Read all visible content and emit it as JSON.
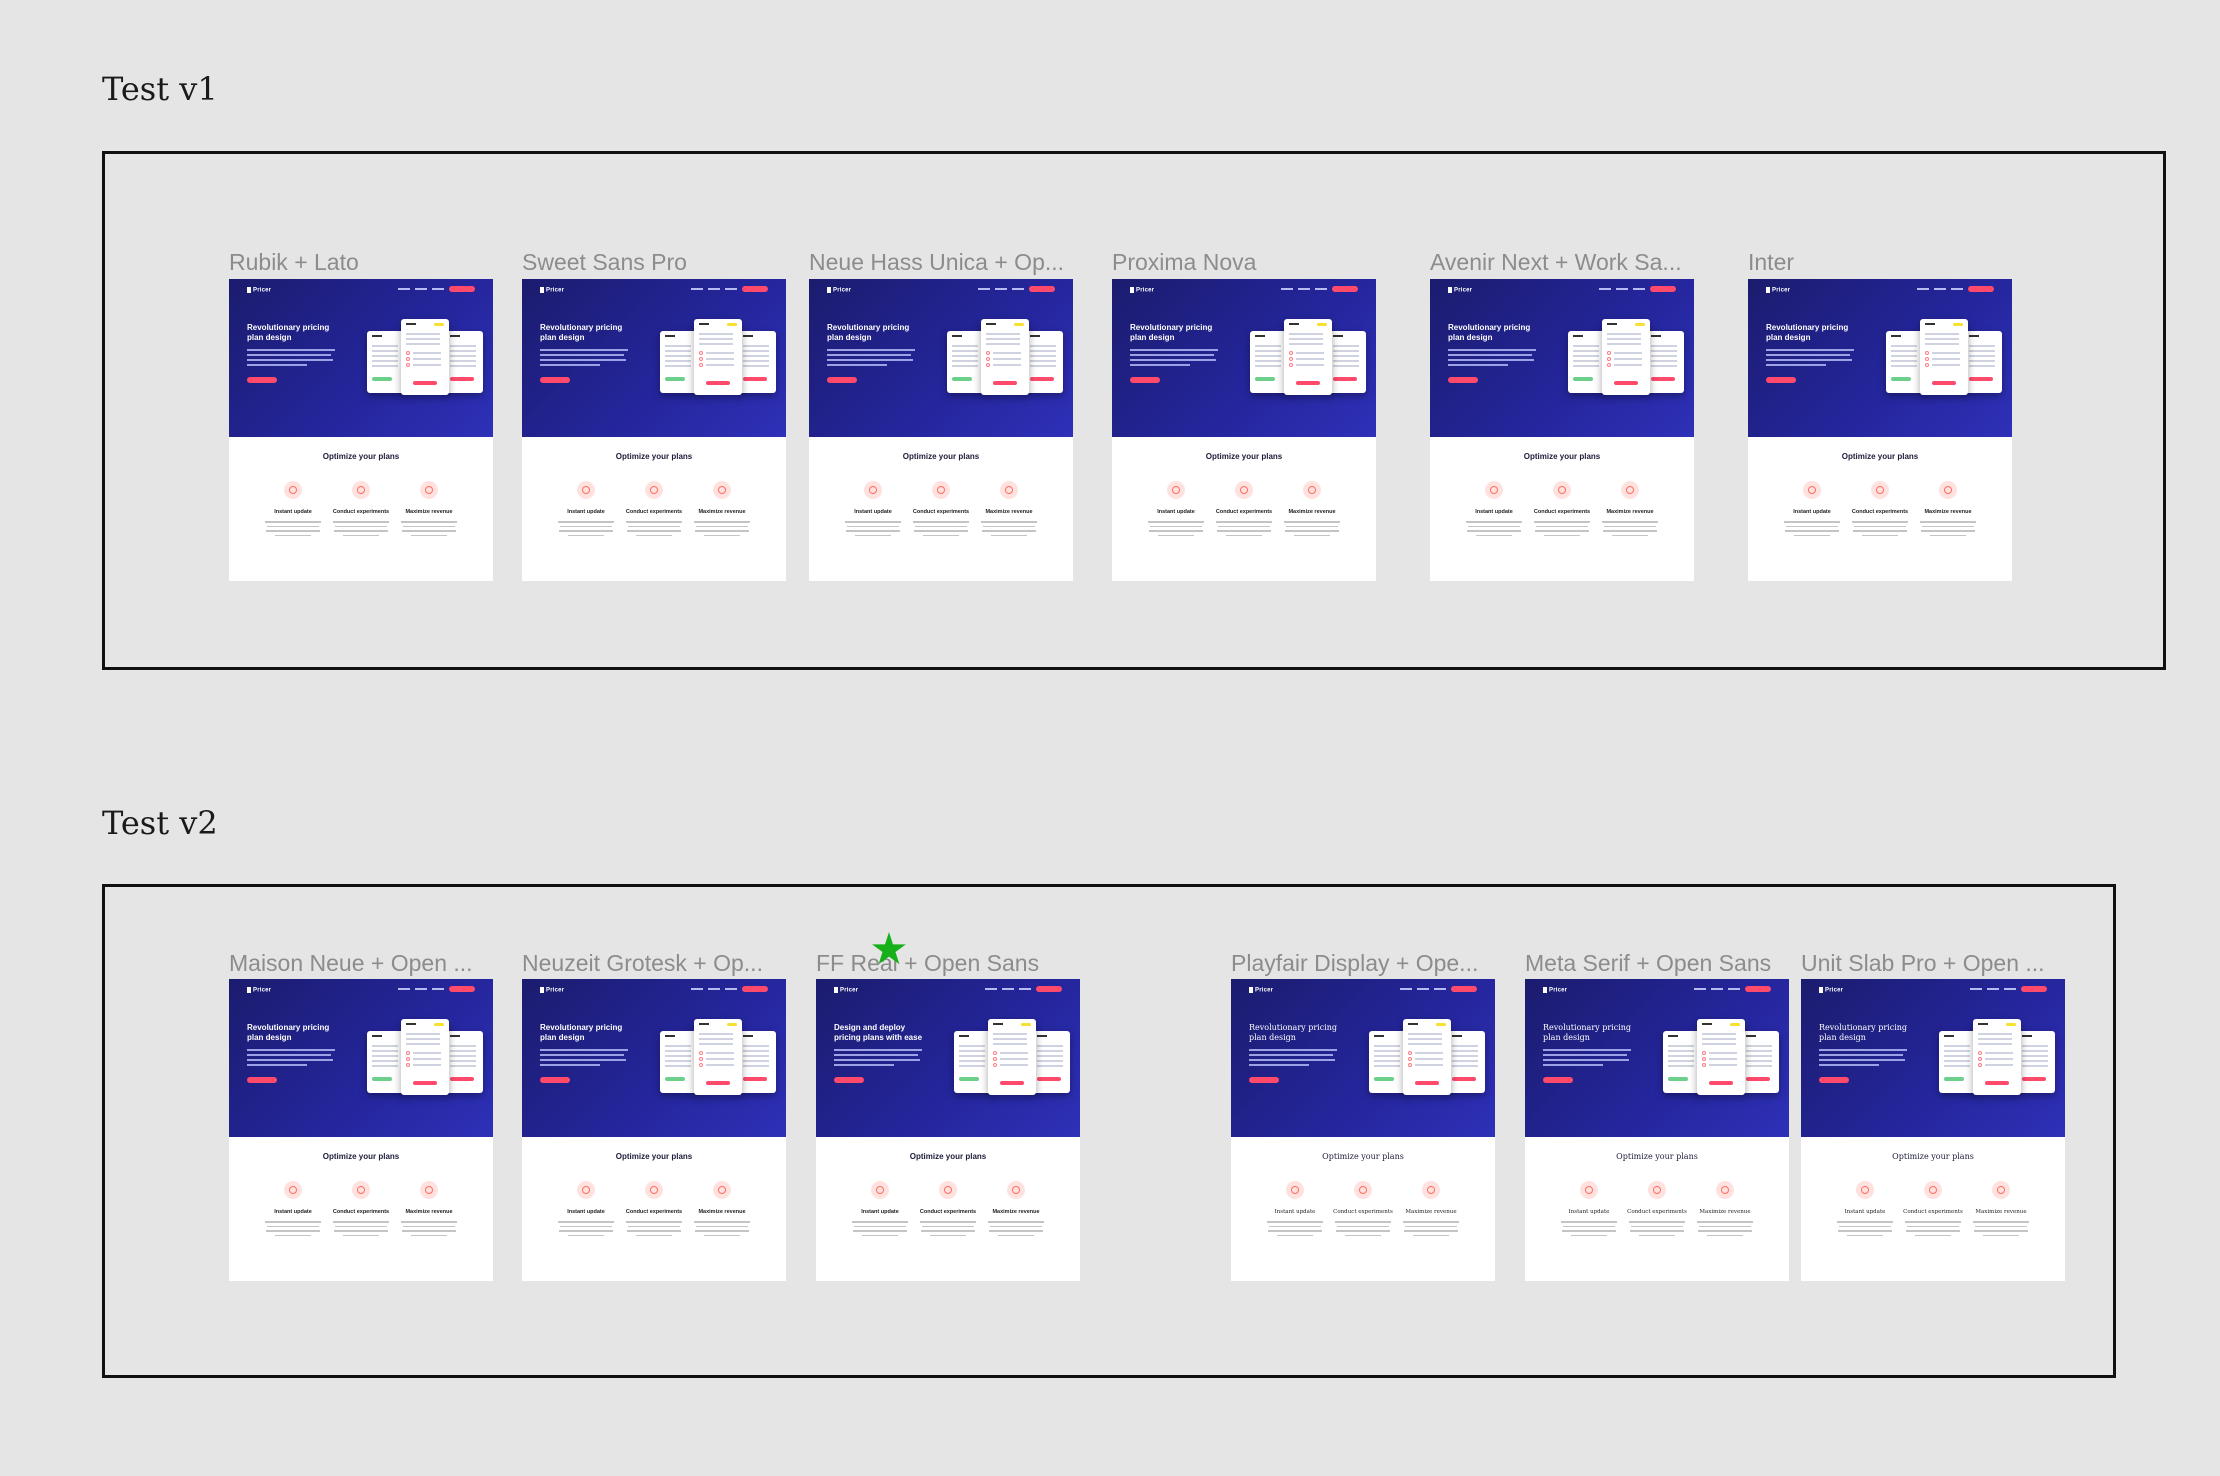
{
  "sections": [
    {
      "title": "Test v1",
      "thumbnails": [
        {
          "label": "Rubik + Lato",
          "headline": "Revolutionary pricing plan design",
          "section_heading": "Optimize your plans",
          "features": [
            "Instant update",
            "Conduct experiments",
            "Maximize revenue"
          ],
          "style": "sans"
        },
        {
          "label": "Sweet Sans Pro",
          "headline": "Revolutionary pricing plan design",
          "section_heading": "Optimize your plans",
          "features": [
            "Instant update",
            "Conduct experiments",
            "Maximize revenue"
          ],
          "style": "sans"
        },
        {
          "label": "Neue Hass Unica + Op...",
          "headline": "Revolutionary pricing plan design",
          "section_heading": "Optimize your plans",
          "features": [
            "Instant update",
            "Conduct experiments",
            "Maximize revenue"
          ],
          "style": "sans"
        },
        {
          "label": "Proxima Nova",
          "headline": "Revolutionary pricing plan design",
          "section_heading": "Optimize your plans",
          "features": [
            "Instant update",
            "Conduct experiments",
            "Maximize revenue"
          ],
          "style": "sans"
        },
        {
          "label": "Avenir Next + Work Sa...",
          "headline": "Revolutionary pricing plan design",
          "section_heading": "Optimize your plans",
          "features": [
            "Instant update",
            "Conduct experiments",
            "Maximize revenue"
          ],
          "style": "sans"
        },
        {
          "label": "Inter",
          "headline": "Revolutionary pricing plan design",
          "section_heading": "Optimize your plans",
          "features": [
            "Instant update",
            "Conduct experiments",
            "Maximize revenue"
          ],
          "style": "sans"
        }
      ]
    },
    {
      "title": "Test v2",
      "thumbnails": [
        {
          "label": "Maison Neue + Open ...",
          "headline": "Revolutionary pricing plan design",
          "section_heading": "Optimize your plans",
          "features": [
            "Instant update",
            "Conduct experiments",
            "Maximize revenue"
          ],
          "style": "sans"
        },
        {
          "label": "Neuzeit Grotesk + Op...",
          "headline": "Revolutionary pricing plan design",
          "section_heading": "Optimize your plans",
          "features": [
            "Instant update",
            "Conduct experiments",
            "Maximize revenue"
          ],
          "style": "sans"
        },
        {
          "label": "FF Real + Open Sans",
          "headline": "Design and deploy pricing plans with ease",
          "section_heading": "Optimize your plans",
          "features": [
            "Instant update",
            "Conduct experiments",
            "Maximize revenue"
          ],
          "style": "sans",
          "starred": true
        },
        {
          "label": "Playfair Display + Ope...",
          "headline": "Revolutionary pricing plan design",
          "section_heading": "Optimize your plans",
          "features": [
            "Instant update",
            "Conduct experiments",
            "Maximize revenue"
          ],
          "style": "serif"
        },
        {
          "label": "Meta Serif + Open Sans",
          "headline": "Revolutionary pricing plan design",
          "section_heading": "Optimize your plans",
          "features": [
            "Instant update",
            "Conduct experiments",
            "Maximize revenue"
          ],
          "style": "serif"
        },
        {
          "label": "Unit Slab Pro + Open ...",
          "headline": "Revolutionary pricing plan design",
          "section_heading": "Optimize your plans",
          "features": [
            "Instant update",
            "Conduct experiments",
            "Maximize revenue"
          ],
          "style": "serif"
        }
      ]
    }
  ],
  "thumbnail_logo": "Pricer",
  "star_glyph": "★",
  "colors": {
    "canvas": "#e5e5e5",
    "hero": "#24259a",
    "accent": "#ff4a6b",
    "star": "#16b01a"
  }
}
